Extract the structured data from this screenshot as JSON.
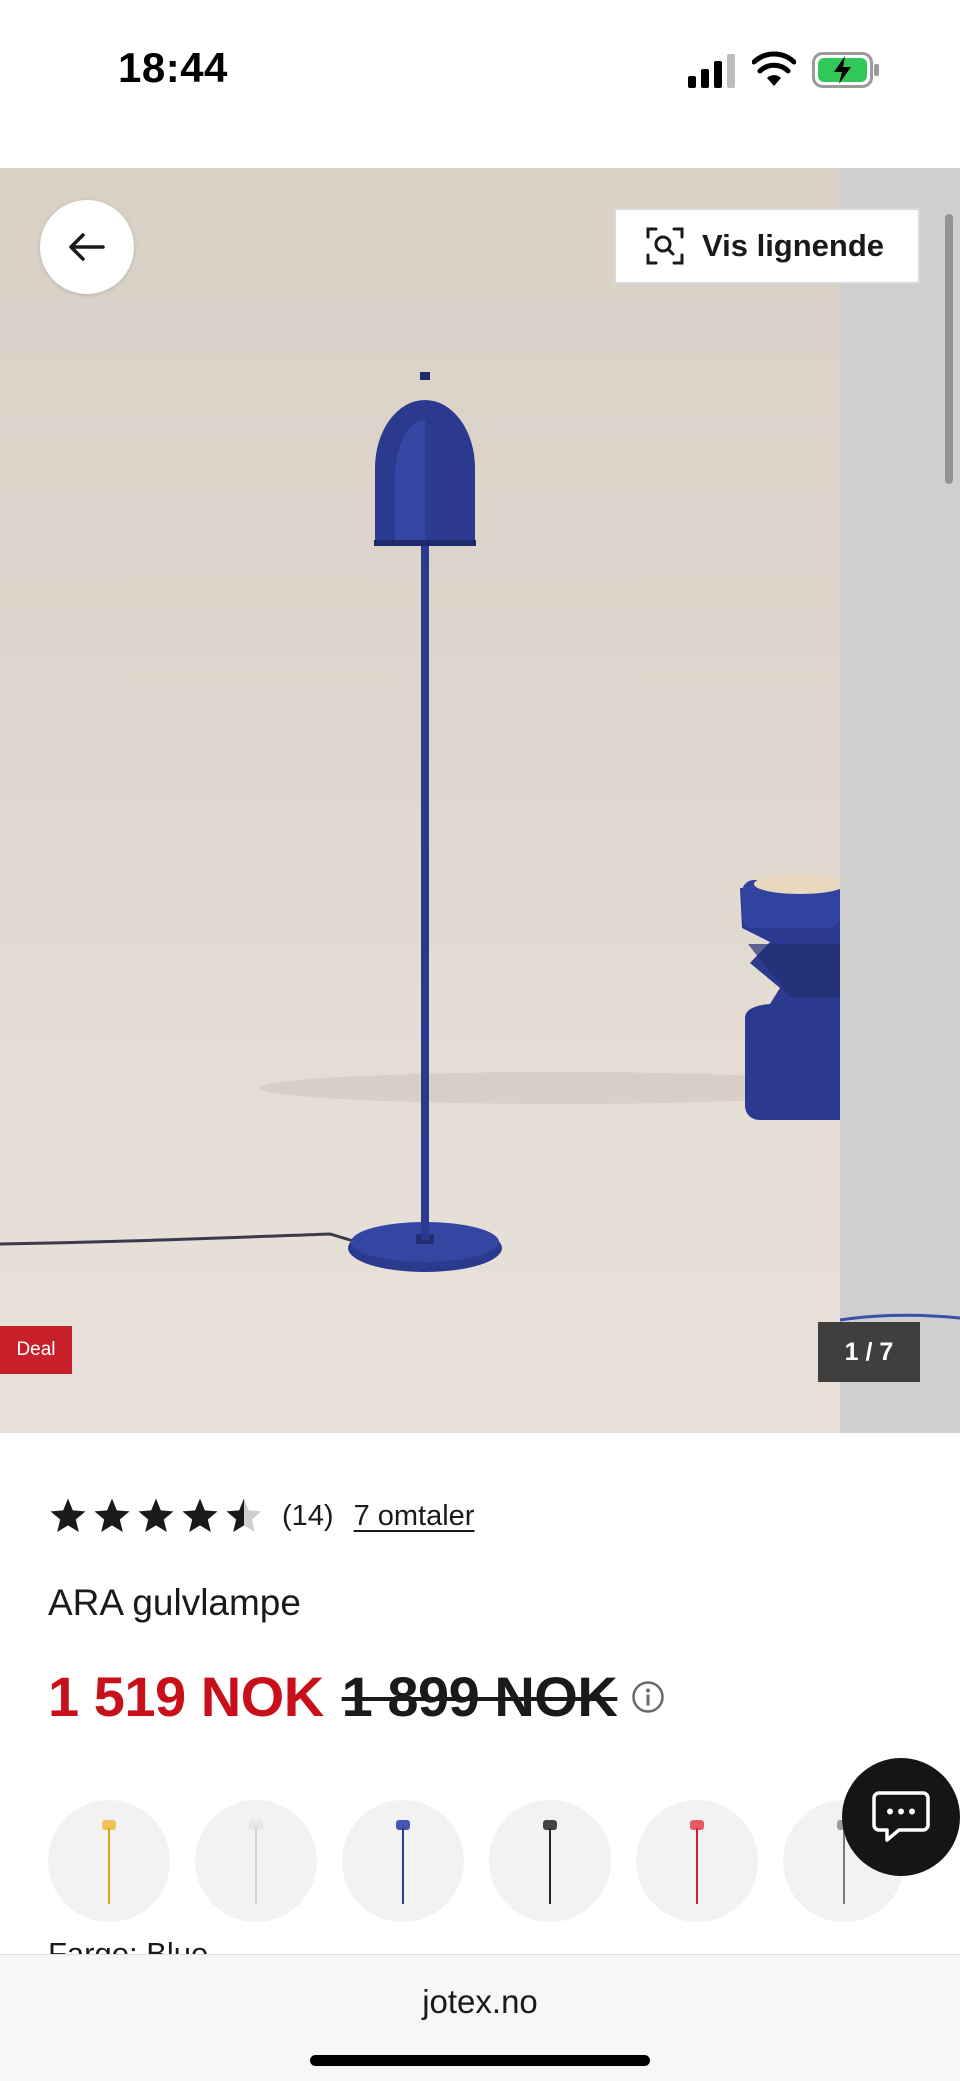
{
  "status_bar": {
    "time": "18:44",
    "icons": [
      "cellular-signal-icon",
      "wifi-icon",
      "battery-charging-icon"
    ]
  },
  "gallery": {
    "similar_button_label": "Vis lignende",
    "deal_badge": "Deal",
    "counter": "1 / 7",
    "icons": [
      "back-arrow-icon",
      "visual-search-icon"
    ]
  },
  "product": {
    "rating_value": 4.5,
    "rating_count": "(14)",
    "reviews_link": "7 omtaler",
    "title": "ARA gulvlampe",
    "price_current": "1 519 NOK",
    "price_original": "1 899 NOK",
    "color_label": "Farge: Blue"
  },
  "swatches": [
    {
      "color": "#e3a21a",
      "shade": "#f0c25a"
    },
    {
      "color": "#d2d2d2",
      "shade": "#e8e8e8"
    },
    {
      "color": "#2b3a8f",
      "shade": "#4456b2"
    },
    {
      "color": "#262626",
      "shade": "#444444"
    },
    {
      "color": "#d2232a",
      "shade": "#e85a60"
    },
    {
      "color": "#7a7a7a",
      "shade": "#9a9a9a"
    }
  ],
  "colors": {
    "sale_red": "#c8101b",
    "deal_red": "#c8202a",
    "lamp_blue": "#2b3a8f"
  },
  "browser": {
    "url": "jotex.no"
  }
}
